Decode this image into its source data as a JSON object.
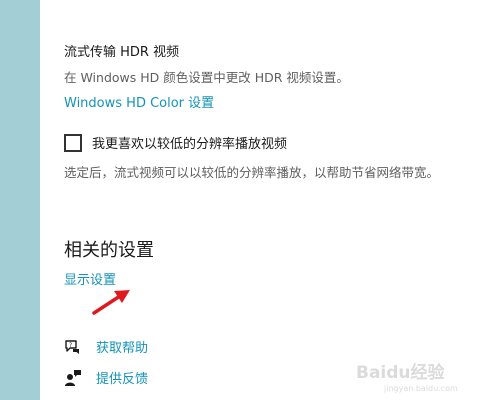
{
  "hdr": {
    "title": "流式传输 HDR 视频",
    "description": "在 Windows HD 颜色设置中更改 HDR 视频设置。",
    "link": "Windows HD Color 设置"
  },
  "low_res": {
    "checkbox_label": "我更喜欢以较低的分辨率播放视频",
    "checked": false,
    "description": "选定后，流式视频可以以较低的分辨率播放，以帮助节省网络带宽。"
  },
  "related": {
    "heading": "相关的设置",
    "display_link": "显示设置"
  },
  "help": {
    "get_help": "获取帮助",
    "feedback": "提供反馈"
  },
  "watermark": {
    "text": "Baidu经验",
    "url": "jingyan.baidu.com"
  },
  "colors": {
    "link": "#1493b8",
    "sidebar": "#a3ced6",
    "arrow": "#e0191e"
  }
}
